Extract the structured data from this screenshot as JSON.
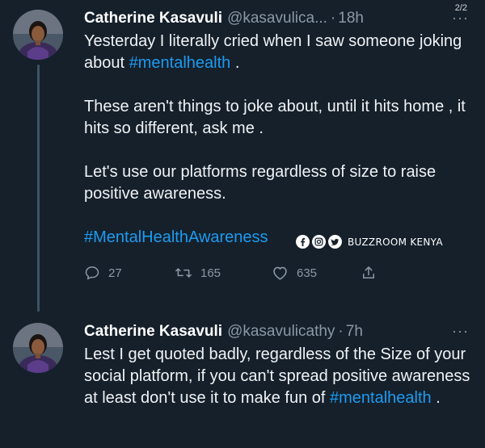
{
  "page_counter": "2/2",
  "tweets": [
    {
      "name": "Catherine Kasavuli",
      "handle": "@kasavulica...",
      "separator": "·",
      "time": "18h",
      "more": "···",
      "paragraphs": [
        {
          "pre": "Yesterday I literally cried when I saw someone joking about ",
          "tag": "#mentalhealth",
          "post": " ."
        },
        {
          "text": "These aren't things to joke about,  until it hits home , it hits so different, ask me ."
        },
        {
          "text": "Let's use our platforms regardless of size to raise positive awareness."
        },
        {
          "tag": "#MentalHealthAwareness"
        }
      ],
      "actions": {
        "replies": "27",
        "retweets": "165",
        "likes": "635"
      }
    },
    {
      "name": "Catherine Kasavuli",
      "handle": "@kasavulicathy",
      "separator": "·",
      "time": "7h",
      "more": "···",
      "paragraph": {
        "pre": "Lest I get quoted badly, regardless of the Size of your social platform, if you can't spread positive awareness at least don't use it to make fun of ",
        "tag": "#mentalhealth",
        "post": " ."
      }
    }
  ],
  "watermark": {
    "text": "BUZZROOM KENYA",
    "icons": [
      "facebook-icon",
      "instagram-icon",
      "twitter-icon"
    ]
  },
  "colors": {
    "background": "#15202b",
    "link": "#1d9bf0",
    "muted": "#8b98a5"
  }
}
